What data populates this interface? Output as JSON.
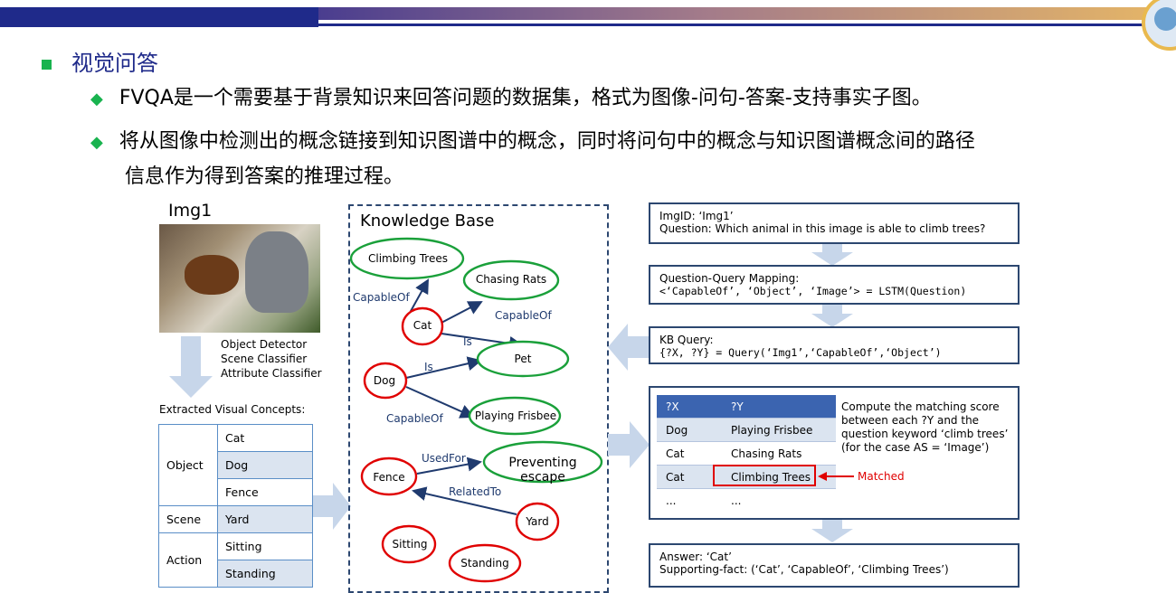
{
  "header": {
    "section_title": "视觉问答"
  },
  "bullets": [
    "FVQA是一个需要基于背景知识来回答问题的数据集，格式为图像-问句-答案-支持事实子图。",
    "将从图像中检测出的概念链接到知识图谱中的概念，同时将问句中的概念与知识图谱概念间的路径",
    "信息作为得到答案的推理过程。"
  ],
  "left": {
    "img_label": "Img1",
    "detectors": [
      "Object Detector",
      "Scene Classifier",
      "Attribute Classifier"
    ],
    "concepts_title": "Extracted Visual Concepts:",
    "concept_groups": [
      {
        "category": "Object",
        "values": [
          "Cat",
          "Dog",
          "Fence"
        ]
      },
      {
        "category": "Scene",
        "values": [
          "Yard"
        ]
      },
      {
        "category": "Action",
        "values": [
          "Sitting",
          "Standing"
        ]
      }
    ]
  },
  "kb": {
    "title": "Knowledge Base",
    "nodes": [
      "Climbing Trees",
      "Chasing Rats",
      "Cat",
      "Pet",
      "Dog",
      "Playing Frisbee",
      "Fence",
      "Preventing escape",
      "Yard",
      "Sitting",
      "Standing"
    ],
    "edges": [
      "CapableOf",
      "CapableOf",
      "Is",
      "Is",
      "CapableOf",
      "UsedFor",
      "RelatedTo"
    ]
  },
  "right": {
    "box1": {
      "line1": "ImgID: ‘Img1’",
      "line2": "Question: Which animal in this image is able to climb trees?"
    },
    "box2": {
      "line1": "Question-Query Mapping:",
      "line2": "<‘CapableOf’, ‘Object’, ‘Image’> = LSTM(Question)"
    },
    "box3": {
      "line1": "KB Query:",
      "line2": "{?X, ?Y} = Query(‘Img1’,‘CapableOf’,‘Object’)"
    },
    "results": {
      "headers": [
        "?X",
        "?Y"
      ],
      "rows": [
        [
          "Dog",
          "Playing Frisbee"
        ],
        [
          "Cat",
          "Chasing Rats"
        ],
        [
          "Cat",
          "Climbing Trees"
        ],
        [
          "...",
          "..."
        ]
      ]
    },
    "compute_text": [
      "Compute the matching score",
      "between each ?Y and the",
      "question keyword ‘climb trees’",
      "(for the case AS = ‘Image’)"
    ],
    "matched_label": "Matched",
    "answer": {
      "line1": "Answer: ‘Cat’",
      "line2": "Supporting-fact: (‘Cat’, ‘CapableOf’, ‘Climbing Trees’)"
    }
  },
  "colors": {
    "accent_green": "#19b34f",
    "title_blue": "#1f2a8a",
    "node_red": "#e00000",
    "node_green": "#1aa03a",
    "arrow_blue": "#1f3a6e"
  }
}
